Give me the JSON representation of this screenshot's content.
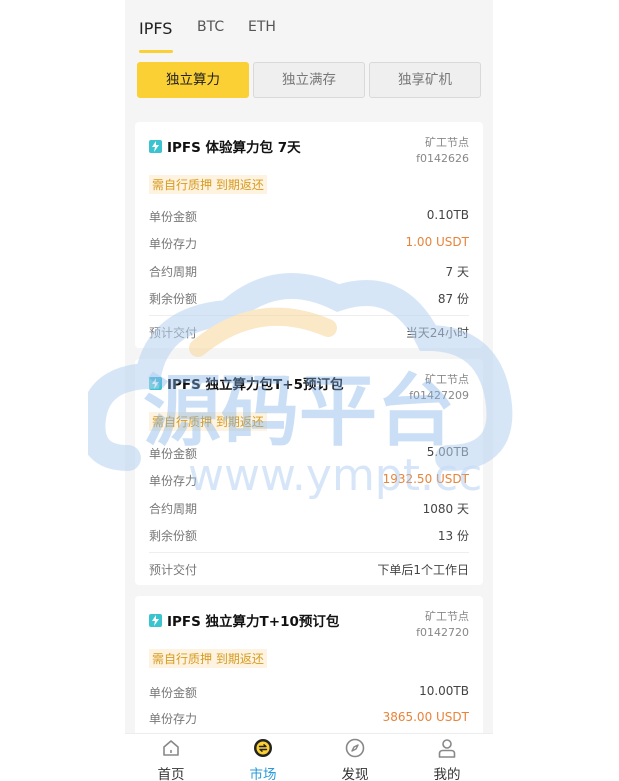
{
  "coin_tabs": [
    "IPFS",
    "BTC",
    "ETH"
  ],
  "type_tabs": [
    "独立算力",
    "独立满存",
    "独享矿机"
  ],
  "labels": {
    "unit_amount": "单份金额",
    "unit_deposit": "单份存力",
    "period": "合约周期",
    "remaining": "剩余份额",
    "delivery": "预计交付",
    "node": "矿工节点",
    "tag": "需自行质押 到期返还"
  },
  "products": [
    {
      "title": "IPFS 体验算力包 7天",
      "node_id": "f0142626",
      "amount": "0.10TB",
      "deposit": "1.00 USDT",
      "period": "7 天",
      "remaining": "87 份",
      "delivery": "当天24小时"
    },
    {
      "title": "IPFS 独立算力包T+5预订包",
      "node_id": "f01427209",
      "amount": "5.00TB",
      "deposit": "1932.50 USDT",
      "period": "1080 天",
      "remaining": "13 份",
      "delivery": "下单后1个工作日"
    },
    {
      "title": "IPFS 独立算力T+10预订包",
      "node_id": "f0142720",
      "amount": "10.00TB",
      "deposit": "3865.00 USDT"
    }
  ],
  "watermark": {
    "cn": "源码平台",
    "url": "www.ympt.cc"
  },
  "nav": [
    "首页",
    "市场",
    "发现",
    "我的"
  ],
  "colors": {
    "accent": "#fbd035",
    "orange": "#e8843a",
    "active_nav": "#2b9bd9",
    "tag_text": "#d89b1f"
  }
}
